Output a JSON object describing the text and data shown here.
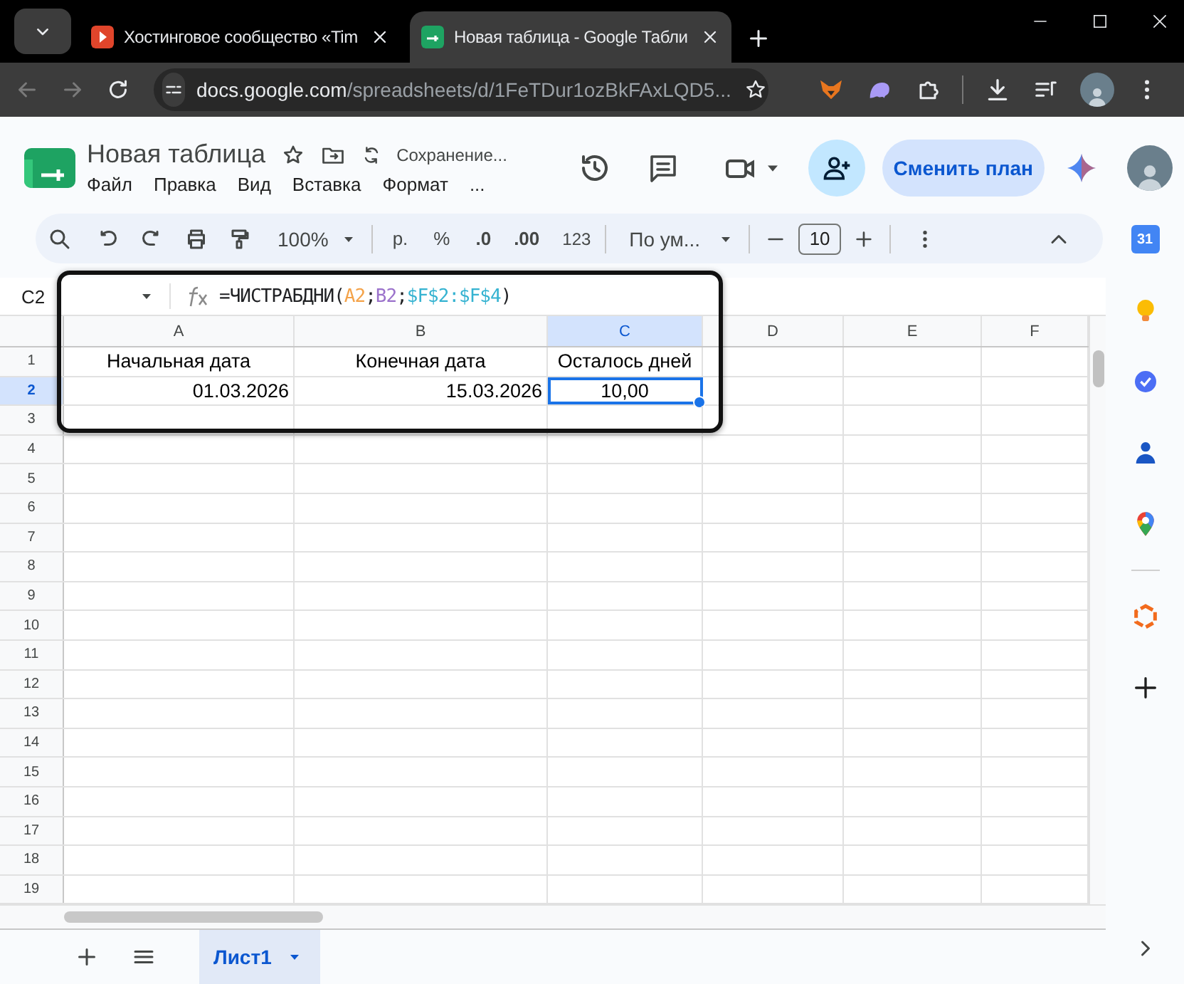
{
  "browser": {
    "tabs": [
      {
        "title": "Хостинговое сообщество «Tim",
        "selected": false
      },
      {
        "title": "Новая таблица - Google Табли",
        "selected": true
      }
    ],
    "address": {
      "host": "docs.google.com",
      "path": "/spreadsheets/d/1FeTDur1ozBkFAxLQD5..."
    }
  },
  "document": {
    "title": "Новая таблица",
    "save_status": "Сохранение...",
    "menus": [
      "Файл",
      "Правка",
      "Вид",
      "Вставка",
      "Формат",
      "..."
    ],
    "plan_button": "Сменить план"
  },
  "toolbar": {
    "zoom": "100%",
    "currency": "р.",
    "percent": "%",
    "decrease_decimals": ".0",
    "increase_decimals": ".00",
    "number_format": "123",
    "font": "По ум...",
    "font_size": "10"
  },
  "formula_bar": {
    "cell": "C2",
    "formula": [
      {
        "text": "=ЧИСТРАБДНИ(",
        "color": "#202124"
      },
      {
        "text": "A2",
        "color": "#f4a34a"
      },
      {
        "text": ";",
        "color": "#202124"
      },
      {
        "text": "B2",
        "color": "#9b72cb"
      },
      {
        "text": ";",
        "color": "#202124"
      },
      {
        "text": "$F$2:$F$4",
        "color": "#36b3d1"
      },
      {
        "text": ")",
        "color": "#202124"
      }
    ]
  },
  "grid": {
    "columns": [
      {
        "label": "A",
        "selected": false
      },
      {
        "label": "B",
        "selected": false
      },
      {
        "label": "C",
        "selected": true
      },
      {
        "label": "D",
        "selected": false
      },
      {
        "label": "E",
        "selected": false
      },
      {
        "label": "F",
        "selected": false
      }
    ],
    "rows": [
      {
        "label": "1",
        "selected": false,
        "cells": [
          {
            "text": "Начальная дата",
            "selected": false
          },
          {
            "text": "Конечная дата",
            "selected": false
          },
          {
            "text": "Осталось дней",
            "selected": false
          }
        ]
      },
      {
        "label": "2",
        "selected": true,
        "cells": [
          {
            "text": "01.03.2026",
            "selected": false
          },
          {
            "text": "15.03.2026",
            "selected": false
          },
          {
            "text": "10,00",
            "selected": true
          }
        ]
      },
      {
        "label": "3",
        "selected": false,
        "cells": []
      },
      {
        "label": "4",
        "selected": false,
        "cells": []
      },
      {
        "label": "5",
        "selected": false,
        "cells": []
      },
      {
        "label": "6",
        "selected": false,
        "cells": []
      },
      {
        "label": "7",
        "selected": false,
        "cells": []
      },
      {
        "label": "8",
        "selected": false,
        "cells": []
      },
      {
        "label": "9",
        "selected": false,
        "cells": []
      },
      {
        "label": "10",
        "selected": false,
        "cells": []
      },
      {
        "label": "11",
        "selected": false,
        "cells": []
      },
      {
        "label": "12",
        "selected": false,
        "cells": []
      },
      {
        "label": "13",
        "selected": false,
        "cells": []
      },
      {
        "label": "14",
        "selected": false,
        "cells": []
      },
      {
        "label": "15",
        "selected": false,
        "cells": []
      },
      {
        "label": "16",
        "selected": false,
        "cells": []
      },
      {
        "label": "17",
        "selected": false,
        "cells": []
      },
      {
        "label": "18",
        "selected": false,
        "cells": []
      },
      {
        "label": "19",
        "selected": false,
        "cells": []
      }
    ]
  },
  "side_panel": {
    "calendar_date": "31"
  },
  "sheets": [
    {
      "name": "Лист1",
      "selected": true
    }
  ]
}
